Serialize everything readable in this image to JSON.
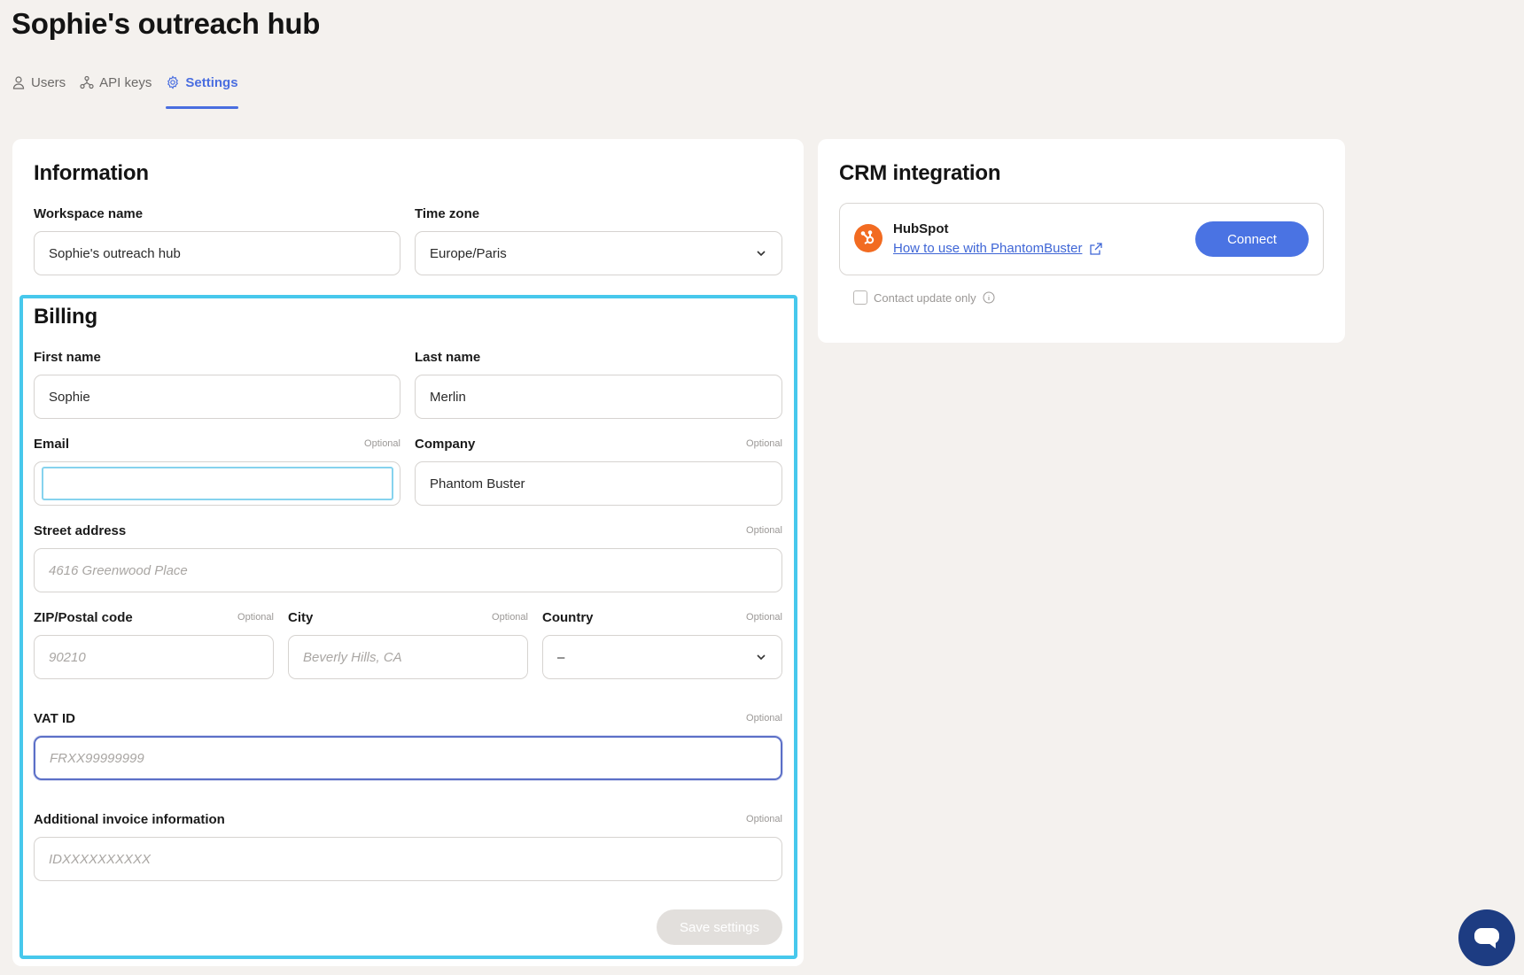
{
  "page": {
    "title": "Sophie's outreach hub"
  },
  "tabs": [
    {
      "label": "Users",
      "icon": "user-icon",
      "active": false
    },
    {
      "label": "API keys",
      "icon": "api-keys-icon",
      "active": false
    },
    {
      "label": "Settings",
      "icon": "gear-icon",
      "active": true
    }
  ],
  "information": {
    "heading": "Information",
    "workspace_label": "Workspace name",
    "workspace_value": "Sophie's outreach hub",
    "timezone_label": "Time zone",
    "timezone_value": "Europe/Paris"
  },
  "billing": {
    "heading": "Billing",
    "first_name_label": "First name",
    "first_name_value": "Sophie",
    "last_name_label": "Last name",
    "last_name_value": "Merlin",
    "email_label": "Email",
    "email_optional": "Optional",
    "email_value": "",
    "company_label": "Company",
    "company_optional": "Optional",
    "company_value": "Phantom Buster",
    "street_label": "Street address",
    "street_optional": "Optional",
    "street_placeholder": "4616 Greenwood Place",
    "zip_label": "ZIP/Postal code",
    "zip_optional": "Optional",
    "zip_placeholder": "90210",
    "city_label": "City",
    "city_optional": "Optional",
    "city_placeholder": "Beverly Hills, CA",
    "country_label": "Country",
    "country_optional": "Optional",
    "country_value": "–",
    "vat_label": "VAT ID",
    "vat_optional": "Optional",
    "vat_placeholder": "FRXX99999999",
    "invoice_label": "Additional invoice information",
    "invoice_optional": "Optional",
    "invoice_placeholder": "IDXXXXXXXXXX",
    "save_label": "Save settings"
  },
  "crm": {
    "heading": "CRM integration",
    "provider_name": "HubSpot",
    "provider_link": "How to use with PhantomBuster",
    "connect_label": "Connect",
    "contact_update_label": "Contact update only",
    "contact_update_checked": false
  },
  "colors": {
    "accent": "#4a73e3",
    "billing_highlight": "#47c8ec",
    "hubspot_orange": "#f26b21",
    "chat_bubble": "#1d3c82"
  }
}
